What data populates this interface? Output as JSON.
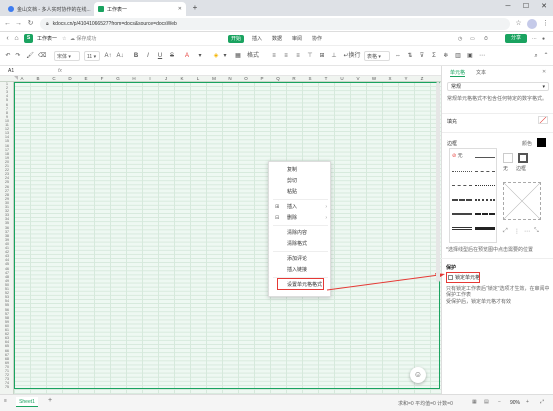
{
  "browser": {
    "tabs": [
      {
        "title": "金山文档 - 多人实时协作的在线..."
      },
      {
        "title": "工作表一"
      }
    ],
    "url": "kdocs.cn/p/41041066527?from=docs&source=docsWeb"
  },
  "app": {
    "doc_title": "工作表一",
    "save_status": "保存成功",
    "logo_letter": "S",
    "menu_tabs": [
      "开始",
      "插入",
      "数据",
      "审阅",
      "协作"
    ],
    "share_label": "分享",
    "accent": "#1aa360"
  },
  "toolbar": {
    "font_name": "宋体",
    "font_size": "11",
    "bold": "B",
    "italic": "I",
    "underline": "U",
    "strike": "S",
    "font_color": "A",
    "format_label": "格式",
    "wrap_label": "换行",
    "table_style_label": "表格"
  },
  "formula_bar": {
    "cell_ref": "A1",
    "fx": "fx"
  },
  "grid": {
    "columns": [
      "A",
      "B",
      "C",
      "D",
      "E",
      "F",
      "G",
      "H",
      "I",
      "J",
      "K",
      "L",
      "M",
      "N",
      "O",
      "P",
      "Q",
      "R",
      "S",
      "T",
      "U",
      "V",
      "W",
      "X",
      "Y",
      "Z"
    ],
    "rows": [
      "1",
      "2",
      "3",
      "4",
      "5",
      "6",
      "7",
      "8",
      "9",
      "10",
      "11",
      "12",
      "13",
      "14",
      "15",
      "16",
      "17",
      "18",
      "19",
      "20",
      "21",
      "22",
      "23",
      "24",
      "25",
      "26",
      "27",
      "28",
      "29",
      "30",
      "31",
      "32",
      "33",
      "34",
      "35",
      "36",
      "37",
      "38",
      "39",
      "40",
      "41",
      "42",
      "43",
      "44",
      "45",
      "46",
      "47",
      "48",
      "49",
      "50",
      "51",
      "52",
      "53",
      "54",
      "55",
      "56",
      "57",
      "58",
      "59",
      "60",
      "61",
      "62",
      "63",
      "64",
      "65",
      "66",
      "67",
      "68",
      "69",
      "70",
      "71",
      "72",
      "73",
      "74",
      "75"
    ]
  },
  "context_menu": {
    "items": [
      {
        "label": "复制"
      },
      {
        "label": "剪切"
      },
      {
        "label": "粘贴"
      },
      {
        "label": "插入",
        "submenu": true
      },
      {
        "label": "删除",
        "submenu": true
      },
      {
        "label": "清除内容"
      },
      {
        "label": "清除格式"
      },
      {
        "label": "添加评论"
      },
      {
        "label": "插入链接"
      },
      {
        "label": "设置单元格格式"
      }
    ]
  },
  "panel": {
    "tabs": [
      "单元格",
      "文本"
    ],
    "number_format_dropdown": "常规",
    "number_format_hint": "常规单元格格式不包含任何特定的数字格式。",
    "fill_label": "填充",
    "border_label": "边框",
    "color_label": "颜色",
    "border_none_label": "无",
    "border_outer_label": "外框",
    "border_outline_label": "边框",
    "border_hint": "*选择线型后在预览图中点击需要的位置",
    "protect_title": "保护",
    "lock_cell_label": "锁定单元格",
    "protect_hint": "只有锁定工作表后\"锁定\"选项才生效，在审阅中保护工作表",
    "protect_hint2": "受保护后，锁定单元格才有效"
  },
  "status_bar": {
    "sheet_name": "Sheet1",
    "stats": "求和=0  平均值=0  计数=0",
    "zoom": "90%"
  }
}
